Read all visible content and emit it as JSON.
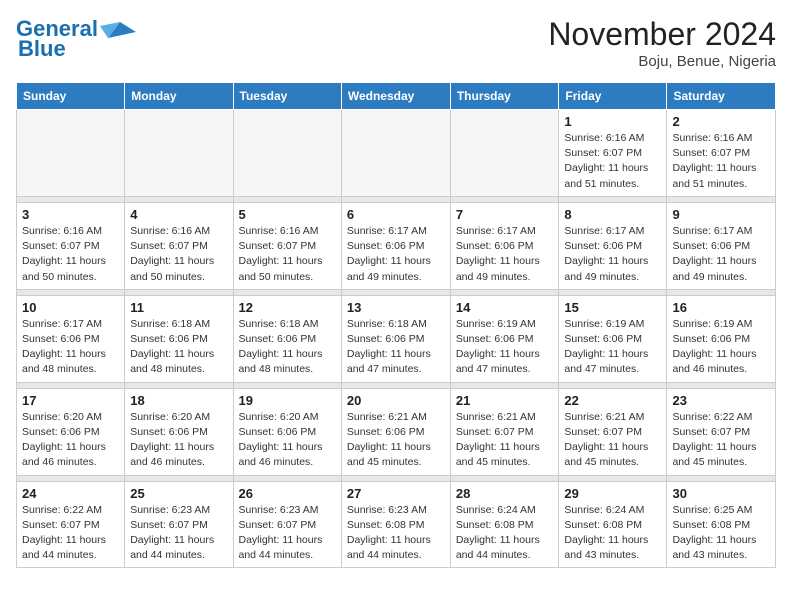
{
  "logo": {
    "line1": "General",
    "line2": "Blue"
  },
  "title": "November 2024",
  "location": "Boju, Benue, Nigeria",
  "days_of_week": [
    "Sunday",
    "Monday",
    "Tuesday",
    "Wednesday",
    "Thursday",
    "Friday",
    "Saturday"
  ],
  "weeks": [
    [
      {
        "day": "",
        "info": ""
      },
      {
        "day": "",
        "info": ""
      },
      {
        "day": "",
        "info": ""
      },
      {
        "day": "",
        "info": ""
      },
      {
        "day": "",
        "info": ""
      },
      {
        "day": "1",
        "info": "Sunrise: 6:16 AM\nSunset: 6:07 PM\nDaylight: 11 hours and 51 minutes."
      },
      {
        "day": "2",
        "info": "Sunrise: 6:16 AM\nSunset: 6:07 PM\nDaylight: 11 hours and 51 minutes."
      }
    ],
    [
      {
        "day": "3",
        "info": "Sunrise: 6:16 AM\nSunset: 6:07 PM\nDaylight: 11 hours and 50 minutes."
      },
      {
        "day": "4",
        "info": "Sunrise: 6:16 AM\nSunset: 6:07 PM\nDaylight: 11 hours and 50 minutes."
      },
      {
        "day": "5",
        "info": "Sunrise: 6:16 AM\nSunset: 6:07 PM\nDaylight: 11 hours and 50 minutes."
      },
      {
        "day": "6",
        "info": "Sunrise: 6:17 AM\nSunset: 6:06 PM\nDaylight: 11 hours and 49 minutes."
      },
      {
        "day": "7",
        "info": "Sunrise: 6:17 AM\nSunset: 6:06 PM\nDaylight: 11 hours and 49 minutes."
      },
      {
        "day": "8",
        "info": "Sunrise: 6:17 AM\nSunset: 6:06 PM\nDaylight: 11 hours and 49 minutes."
      },
      {
        "day": "9",
        "info": "Sunrise: 6:17 AM\nSunset: 6:06 PM\nDaylight: 11 hours and 49 minutes."
      }
    ],
    [
      {
        "day": "10",
        "info": "Sunrise: 6:17 AM\nSunset: 6:06 PM\nDaylight: 11 hours and 48 minutes."
      },
      {
        "day": "11",
        "info": "Sunrise: 6:18 AM\nSunset: 6:06 PM\nDaylight: 11 hours and 48 minutes."
      },
      {
        "day": "12",
        "info": "Sunrise: 6:18 AM\nSunset: 6:06 PM\nDaylight: 11 hours and 48 minutes."
      },
      {
        "day": "13",
        "info": "Sunrise: 6:18 AM\nSunset: 6:06 PM\nDaylight: 11 hours and 47 minutes."
      },
      {
        "day": "14",
        "info": "Sunrise: 6:19 AM\nSunset: 6:06 PM\nDaylight: 11 hours and 47 minutes."
      },
      {
        "day": "15",
        "info": "Sunrise: 6:19 AM\nSunset: 6:06 PM\nDaylight: 11 hours and 47 minutes."
      },
      {
        "day": "16",
        "info": "Sunrise: 6:19 AM\nSunset: 6:06 PM\nDaylight: 11 hours and 46 minutes."
      }
    ],
    [
      {
        "day": "17",
        "info": "Sunrise: 6:20 AM\nSunset: 6:06 PM\nDaylight: 11 hours and 46 minutes."
      },
      {
        "day": "18",
        "info": "Sunrise: 6:20 AM\nSunset: 6:06 PM\nDaylight: 11 hours and 46 minutes."
      },
      {
        "day": "19",
        "info": "Sunrise: 6:20 AM\nSunset: 6:06 PM\nDaylight: 11 hours and 46 minutes."
      },
      {
        "day": "20",
        "info": "Sunrise: 6:21 AM\nSunset: 6:06 PM\nDaylight: 11 hours and 45 minutes."
      },
      {
        "day": "21",
        "info": "Sunrise: 6:21 AM\nSunset: 6:07 PM\nDaylight: 11 hours and 45 minutes."
      },
      {
        "day": "22",
        "info": "Sunrise: 6:21 AM\nSunset: 6:07 PM\nDaylight: 11 hours and 45 minutes."
      },
      {
        "day": "23",
        "info": "Sunrise: 6:22 AM\nSunset: 6:07 PM\nDaylight: 11 hours and 45 minutes."
      }
    ],
    [
      {
        "day": "24",
        "info": "Sunrise: 6:22 AM\nSunset: 6:07 PM\nDaylight: 11 hours and 44 minutes."
      },
      {
        "day": "25",
        "info": "Sunrise: 6:23 AM\nSunset: 6:07 PM\nDaylight: 11 hours and 44 minutes."
      },
      {
        "day": "26",
        "info": "Sunrise: 6:23 AM\nSunset: 6:07 PM\nDaylight: 11 hours and 44 minutes."
      },
      {
        "day": "27",
        "info": "Sunrise: 6:23 AM\nSunset: 6:08 PM\nDaylight: 11 hours and 44 minutes."
      },
      {
        "day": "28",
        "info": "Sunrise: 6:24 AM\nSunset: 6:08 PM\nDaylight: 11 hours and 44 minutes."
      },
      {
        "day": "29",
        "info": "Sunrise: 6:24 AM\nSunset: 6:08 PM\nDaylight: 11 hours and 43 minutes."
      },
      {
        "day": "30",
        "info": "Sunrise: 6:25 AM\nSunset: 6:08 PM\nDaylight: 11 hours and 43 minutes."
      }
    ]
  ]
}
